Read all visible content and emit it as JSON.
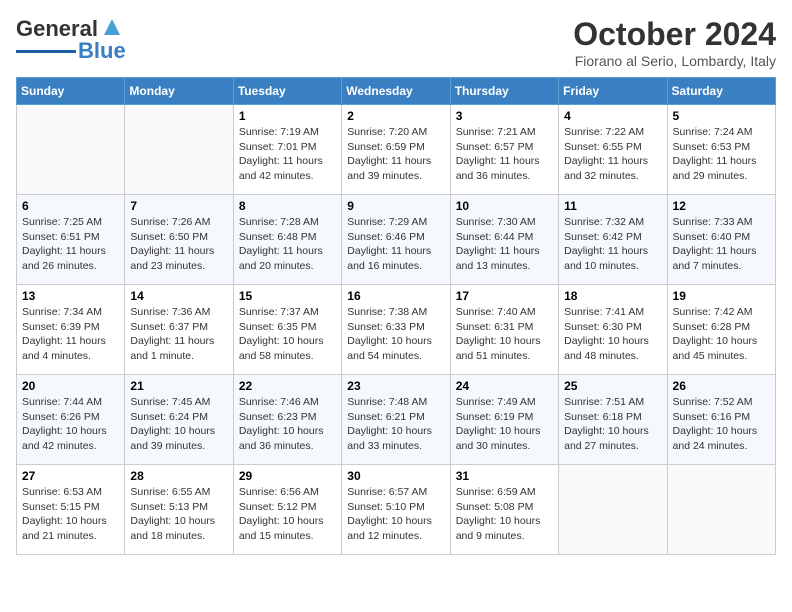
{
  "header": {
    "logo_general": "General",
    "logo_blue": "Blue",
    "month_year": "October 2024",
    "location": "Fiorano al Serio, Lombardy, Italy"
  },
  "weekdays": [
    "Sunday",
    "Monday",
    "Tuesday",
    "Wednesday",
    "Thursday",
    "Friday",
    "Saturday"
  ],
  "weeks": [
    [
      {
        "day": "",
        "info": ""
      },
      {
        "day": "",
        "info": ""
      },
      {
        "day": "1",
        "info": "Sunrise: 7:19 AM\nSunset: 7:01 PM\nDaylight: 11 hours\nand 42 minutes."
      },
      {
        "day": "2",
        "info": "Sunrise: 7:20 AM\nSunset: 6:59 PM\nDaylight: 11 hours\nand 39 minutes."
      },
      {
        "day": "3",
        "info": "Sunrise: 7:21 AM\nSunset: 6:57 PM\nDaylight: 11 hours\nand 36 minutes."
      },
      {
        "day": "4",
        "info": "Sunrise: 7:22 AM\nSunset: 6:55 PM\nDaylight: 11 hours\nand 32 minutes."
      },
      {
        "day": "5",
        "info": "Sunrise: 7:24 AM\nSunset: 6:53 PM\nDaylight: 11 hours\nand 29 minutes."
      }
    ],
    [
      {
        "day": "6",
        "info": "Sunrise: 7:25 AM\nSunset: 6:51 PM\nDaylight: 11 hours\nand 26 minutes."
      },
      {
        "day": "7",
        "info": "Sunrise: 7:26 AM\nSunset: 6:50 PM\nDaylight: 11 hours\nand 23 minutes."
      },
      {
        "day": "8",
        "info": "Sunrise: 7:28 AM\nSunset: 6:48 PM\nDaylight: 11 hours\nand 20 minutes."
      },
      {
        "day": "9",
        "info": "Sunrise: 7:29 AM\nSunset: 6:46 PM\nDaylight: 11 hours\nand 16 minutes."
      },
      {
        "day": "10",
        "info": "Sunrise: 7:30 AM\nSunset: 6:44 PM\nDaylight: 11 hours\nand 13 minutes."
      },
      {
        "day": "11",
        "info": "Sunrise: 7:32 AM\nSunset: 6:42 PM\nDaylight: 11 hours\nand 10 minutes."
      },
      {
        "day": "12",
        "info": "Sunrise: 7:33 AM\nSunset: 6:40 PM\nDaylight: 11 hours\nand 7 minutes."
      }
    ],
    [
      {
        "day": "13",
        "info": "Sunrise: 7:34 AM\nSunset: 6:39 PM\nDaylight: 11 hours\nand 4 minutes."
      },
      {
        "day": "14",
        "info": "Sunrise: 7:36 AM\nSunset: 6:37 PM\nDaylight: 11 hours\nand 1 minute."
      },
      {
        "day": "15",
        "info": "Sunrise: 7:37 AM\nSunset: 6:35 PM\nDaylight: 10 hours\nand 58 minutes."
      },
      {
        "day": "16",
        "info": "Sunrise: 7:38 AM\nSunset: 6:33 PM\nDaylight: 10 hours\nand 54 minutes."
      },
      {
        "day": "17",
        "info": "Sunrise: 7:40 AM\nSunset: 6:31 PM\nDaylight: 10 hours\nand 51 minutes."
      },
      {
        "day": "18",
        "info": "Sunrise: 7:41 AM\nSunset: 6:30 PM\nDaylight: 10 hours\nand 48 minutes."
      },
      {
        "day": "19",
        "info": "Sunrise: 7:42 AM\nSunset: 6:28 PM\nDaylight: 10 hours\nand 45 minutes."
      }
    ],
    [
      {
        "day": "20",
        "info": "Sunrise: 7:44 AM\nSunset: 6:26 PM\nDaylight: 10 hours\nand 42 minutes."
      },
      {
        "day": "21",
        "info": "Sunrise: 7:45 AM\nSunset: 6:24 PM\nDaylight: 10 hours\nand 39 minutes."
      },
      {
        "day": "22",
        "info": "Sunrise: 7:46 AM\nSunset: 6:23 PM\nDaylight: 10 hours\nand 36 minutes."
      },
      {
        "day": "23",
        "info": "Sunrise: 7:48 AM\nSunset: 6:21 PM\nDaylight: 10 hours\nand 33 minutes."
      },
      {
        "day": "24",
        "info": "Sunrise: 7:49 AM\nSunset: 6:19 PM\nDaylight: 10 hours\nand 30 minutes."
      },
      {
        "day": "25",
        "info": "Sunrise: 7:51 AM\nSunset: 6:18 PM\nDaylight: 10 hours\nand 27 minutes."
      },
      {
        "day": "26",
        "info": "Sunrise: 7:52 AM\nSunset: 6:16 PM\nDaylight: 10 hours\nand 24 minutes."
      }
    ],
    [
      {
        "day": "27",
        "info": "Sunrise: 6:53 AM\nSunset: 5:15 PM\nDaylight: 10 hours\nand 21 minutes."
      },
      {
        "day": "28",
        "info": "Sunrise: 6:55 AM\nSunset: 5:13 PM\nDaylight: 10 hours\nand 18 minutes."
      },
      {
        "day": "29",
        "info": "Sunrise: 6:56 AM\nSunset: 5:12 PM\nDaylight: 10 hours\nand 15 minutes."
      },
      {
        "day": "30",
        "info": "Sunrise: 6:57 AM\nSunset: 5:10 PM\nDaylight: 10 hours\nand 12 minutes."
      },
      {
        "day": "31",
        "info": "Sunrise: 6:59 AM\nSunset: 5:08 PM\nDaylight: 10 hours\nand 9 minutes."
      },
      {
        "day": "",
        "info": ""
      },
      {
        "day": "",
        "info": ""
      }
    ]
  ]
}
